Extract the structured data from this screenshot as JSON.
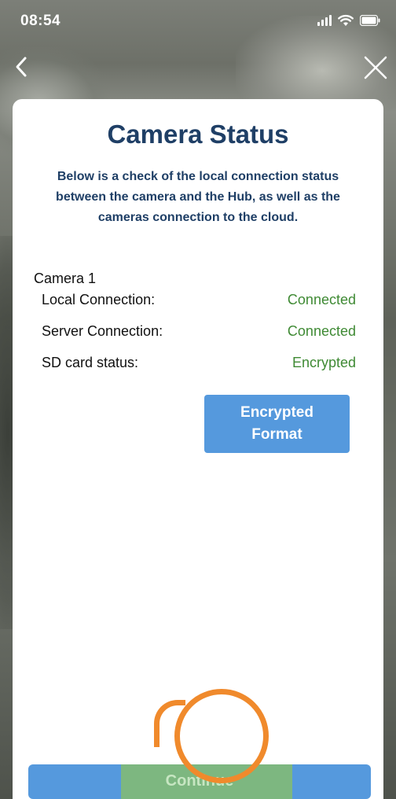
{
  "status_bar": {
    "time": "08:54",
    "icons": [
      "cellular-signal-icon",
      "wifi-icon",
      "battery-icon"
    ]
  },
  "nav": {
    "back_icon": "chevron-left-icon",
    "close_icon": "close-icon"
  },
  "card": {
    "title": "Camera Status",
    "description": "Below is a check of the local connection status between the camera and the Hub, as well as the cameras connection to the cloud.",
    "camera": {
      "name": "Camera 1",
      "rows": [
        {
          "label": "Local Connection:",
          "value": "Connected"
        },
        {
          "label": "Server Connection:",
          "value": "Connected"
        },
        {
          "label": "SD card status:",
          "value": "Encrypted"
        }
      ]
    },
    "encrypted_format_button": "Encrypted Format",
    "continue_button": "Continue"
  },
  "colors": {
    "title": "#1f3f66",
    "status_ok": "#3f8a34",
    "button": "#5599dd",
    "tap_indicator": "#f08a2c"
  }
}
